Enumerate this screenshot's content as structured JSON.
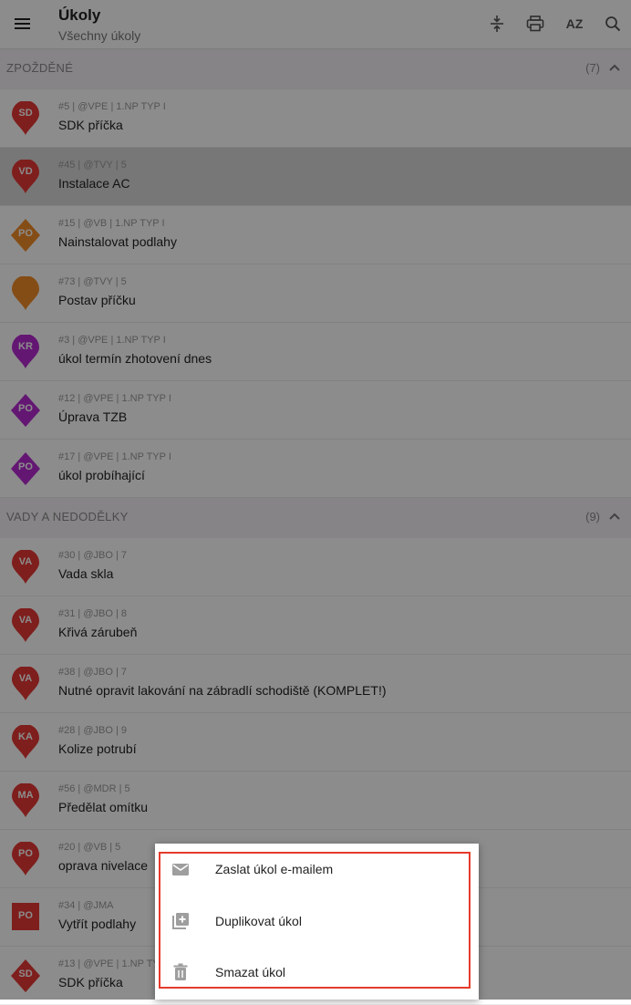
{
  "header": {
    "title": "Úkoly",
    "subtitle": "Všechny úkoly",
    "sort_label": "AZ",
    "menu_icon": "hamburger-menu-icon",
    "tools": [
      "collapse-vertical-icon",
      "print-icon",
      "sort-az-icon",
      "search-icon"
    ]
  },
  "sections": [
    {
      "title": "ZPOŽDĚNÉ",
      "count": "(7)",
      "tasks": [
        {
          "code": "SD",
          "meta": "#5 | @VPE | 1.NP TYP I",
          "name": "SDK příčka",
          "shape": "pin",
          "color": "#e53935"
        },
        {
          "code": "VD",
          "meta": "#45 | @TVY | 5",
          "name": "Instalace AC",
          "shape": "pin",
          "color": "#e53935",
          "selected": true
        },
        {
          "code": "PO",
          "meta": "#15 | @VB | 1.NP TYP I",
          "name": "Nainstalovat podlahy",
          "shape": "diamond",
          "color": "#f28c28"
        },
        {
          "code": "",
          "meta": "#73 | @TVY | 5",
          "name": "Postav příčku",
          "shape": "pin",
          "color": "#f28c28"
        },
        {
          "code": "KR",
          "meta": "#3 | @VPE | 1.NP TYP I",
          "name": "úkol termín zhotovení dnes",
          "shape": "pin",
          "color": "#b52bd0"
        },
        {
          "code": "PO",
          "meta": "#12 | @VPE | 1.NP TYP I",
          "name": "Úprava TZB",
          "shape": "diamond",
          "color": "#b52bd0"
        },
        {
          "code": "PO",
          "meta": "#17 | @VPE | 1.NP TYP I",
          "name": "úkol probíhající",
          "shape": "diamond",
          "color": "#b52bd0"
        }
      ]
    },
    {
      "title": "VADY A NEDODĚLKY",
      "count": "(9)",
      "tasks": [
        {
          "code": "VA",
          "meta": "#30 | @JBO | 7",
          "name": "Vada skla",
          "shape": "pin",
          "color": "#e53935"
        },
        {
          "code": "VA",
          "meta": "#31 | @JBO | 8",
          "name": "Křivá zárubeň",
          "shape": "pin",
          "color": "#e53935"
        },
        {
          "code": "VA",
          "meta": "#38 | @JBO | 7",
          "name": "Nutné opravit lakování na zábradlí schodiště (KOMPLET!)",
          "shape": "pin",
          "color": "#e53935"
        },
        {
          "code": "KA",
          "meta": "#28 | @JBO | 9",
          "name": "Kolize potrubí",
          "shape": "pin",
          "color": "#e53935"
        },
        {
          "code": "MA",
          "meta": "#56 | @MDR | 5",
          "name": "Předělat omítku",
          "shape": "pin",
          "color": "#e53935"
        },
        {
          "code": "PO",
          "meta": "#20 | @VB | 5",
          "name": "oprava nivelace",
          "shape": "pin",
          "color": "#e53935"
        },
        {
          "code": "PO",
          "meta": "#34 | @JMA",
          "name": "Vytřít podlahy",
          "shape": "square",
          "color": "#e53935"
        },
        {
          "code": "SD",
          "meta": "#13 | @VPE | 1.NP TYP I",
          "name": "SDK příčka",
          "shape": "diamond",
          "color": "#e53935"
        }
      ]
    }
  ],
  "context_menu": {
    "items": [
      {
        "label": "Zaslat úkol e-mailem",
        "icon": "email-icon"
      },
      {
        "label": "Duplikovat úkol",
        "icon": "duplicate-icon"
      },
      {
        "label": "Smazat úkol",
        "icon": "trash-icon"
      }
    ]
  }
}
